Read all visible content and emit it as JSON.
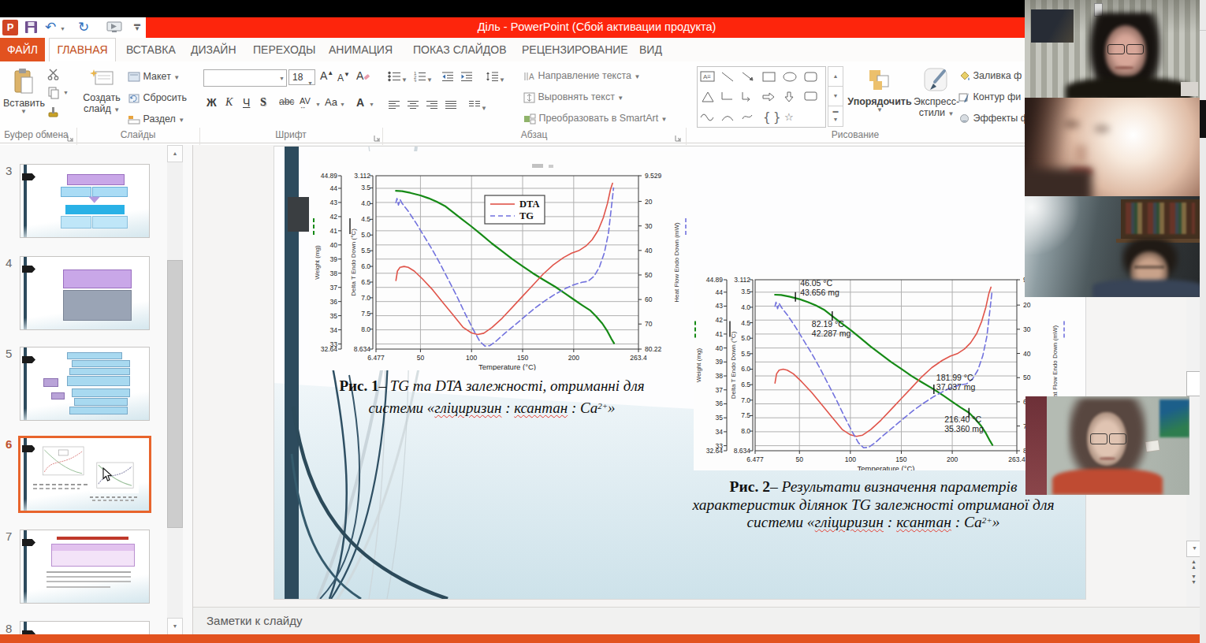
{
  "window": {
    "title": "Діль -  PowerPoint (Сбой активации продукта)"
  },
  "tabs": {
    "file": "ФАЙЛ",
    "items": [
      "ГЛАВНАЯ",
      "ВСТАВКА",
      "ДИЗАЙН",
      "ПЕРЕХОДЫ",
      "АНИМАЦИЯ",
      "ПОКАЗ СЛАЙДОВ",
      "РЕЦЕНЗИРОВАНИЕ",
      "ВИД"
    ]
  },
  "ribbon": {
    "clipboard_group": {
      "paste": "Вставить",
      "label": "Буфер обмена"
    },
    "slides_group": {
      "new_slide_1": "Создать",
      "new_slide_2": "слайд",
      "layout": "Макет",
      "reset": "Сбросить",
      "section": "Раздел",
      "label": "Слайды"
    },
    "font_group": {
      "font_name": "",
      "font_size": "18",
      "bold": "Ж",
      "italic": "К",
      "underline": "Ч",
      "shadow": "S",
      "strike": "abc",
      "spacing": "AV",
      "case": "Aa",
      "color": "А",
      "label": "Шрифт"
    },
    "paragraph_group": {
      "text_direction": "Направление текста",
      "align_text": "Выровнять текст",
      "smartart": "Преобразовать в SmartArt",
      "label": "Абзац"
    },
    "drawing_group": {
      "arrange": "Упорядочить",
      "quick_styles_1": "Экспресс-",
      "quick_styles_2": "стили",
      "fill": "Заливка ф",
      "outline": "Контур фи",
      "effects": "Эффекты ф",
      "label": "Рисование"
    }
  },
  "slide_panel": {
    "numbers": [
      "3",
      "4",
      "5",
      "6",
      "7",
      "8"
    ],
    "selected": "6"
  },
  "notes": {
    "label": "Заметки к слайду"
  },
  "captions": {
    "fig1": {
      "bold": "Рис. 1",
      "rest": "– TG та DTA залежності, отриманні для",
      "l2a": "системи «",
      "w1": "гліциризин",
      "m1": " : ",
      "w2": "ксантан",
      "m2": " : Ca",
      "sup": "2+",
      "end": "»"
    },
    "fig2": {
      "bold": "Рис. 2",
      "rest": "– Результати визначення параметрів",
      "line2": "характеристик ділянок TG залежності отриманої для",
      "l3a": "системи «",
      "w1": "гліциризин",
      "m1": " : ",
      "w2": "ксантан",
      "m2": " : Ca",
      "sup": "2+",
      "end": "»"
    }
  },
  "chart_data": {
    "type": "line",
    "xlabel": "Temperature (°C)",
    "x_ticks": [
      "6.477",
      "50",
      "100",
      "150",
      "200",
      "263.4"
    ],
    "axes": {
      "weight": {
        "title": "Weight (mg)",
        "top": "44.89",
        "bottom": "32.64",
        "ticks": [
          "44",
          "43",
          "42",
          "41",
          "40",
          "39",
          "38",
          "37",
          "36",
          "35",
          "34",
          "33"
        ],
        "range": [
          32.64,
          44.89
        ]
      },
      "delta": {
        "title": "Delta T Endo Down (°C)",
        "top": "3.112",
        "bottom": "8.634",
        "ticks": [
          "3.5",
          "4.0",
          "4.5",
          "5.0",
          "5.5",
          "6.0",
          "6.5",
          "7.0",
          "7.5",
          "8.0"
        ],
        "range": [
          3.112,
          8.634
        ]
      },
      "heat": {
        "title": "Heat Flow Endo Down (mW)",
        "top": "9.529",
        "bottom": "80.22",
        "ticks": [
          "20",
          "30",
          "40",
          "50",
          "60",
          "70"
        ],
        "range": [
          9.529,
          80.22
        ]
      }
    },
    "series": [
      {
        "name": "TG weight",
        "axis": "weight",
        "color": "#168a16",
        "style": "solid",
        "width": 2.2,
        "points": [
          [
            26,
            43.82
          ],
          [
            32,
            43.8
          ],
          [
            40,
            43.68
          ],
          [
            50,
            43.5
          ],
          [
            58,
            43.3
          ],
          [
            66,
            43.05
          ],
          [
            74,
            42.75
          ],
          [
            82.19,
            42.287
          ],
          [
            90,
            41.85
          ],
          [
            100,
            41.3
          ],
          [
            110,
            40.7
          ],
          [
            120,
            40.1
          ],
          [
            130,
            39.55
          ],
          [
            140,
            39.0
          ],
          [
            150,
            38.5
          ],
          [
            160,
            38.0
          ],
          [
            170,
            37.55
          ],
          [
            181.99,
            37.037
          ],
          [
            192,
            36.55
          ],
          [
            200,
            36.15
          ],
          [
            208,
            35.75
          ],
          [
            216.4,
            35.36
          ],
          [
            222,
            34.95
          ],
          [
            228,
            34.45
          ],
          [
            233,
            33.9
          ],
          [
            237,
            33.35
          ],
          [
            239.5,
            33.05
          ]
        ]
      },
      {
        "name": "DTA",
        "axis": "delta",
        "color": "#e0544a",
        "style": "solid",
        "width": 1.6,
        "points": [
          [
            26,
            6.45
          ],
          [
            27.5,
            6.15
          ],
          [
            30,
            6.03
          ],
          [
            34,
            6.0
          ],
          [
            38,
            6.03
          ],
          [
            44,
            6.15
          ],
          [
            52,
            6.4
          ],
          [
            62,
            6.75
          ],
          [
            72,
            7.15
          ],
          [
            82,
            7.55
          ],
          [
            92,
            7.95
          ],
          [
            100,
            8.12
          ],
          [
            106,
            8.17
          ],
          [
            112,
            8.13
          ],
          [
            120,
            7.95
          ],
          [
            130,
            7.65
          ],
          [
            140,
            7.3
          ],
          [
            150,
            6.95
          ],
          [
            160,
            6.6
          ],
          [
            170,
            6.25
          ],
          [
            180,
            5.95
          ],
          [
            190,
            5.72
          ],
          [
            198,
            5.58
          ],
          [
            205,
            5.5
          ],
          [
            212,
            5.35
          ],
          [
            218,
            5.15
          ],
          [
            224,
            4.85
          ],
          [
            229,
            4.45
          ],
          [
            233,
            4.0
          ],
          [
            236,
            3.55
          ],
          [
            238,
            3.35
          ]
        ]
      },
      {
        "name": "TG heat flow",
        "axis": "heat",
        "color": "#7272de",
        "style": "dashed",
        "width": 1.6,
        "points": [
          [
            26,
            20.5
          ],
          [
            27,
            18.8
          ],
          [
            28.5,
            21.5
          ],
          [
            30,
            19.2
          ],
          [
            32,
            20.8
          ],
          [
            38,
            24
          ],
          [
            46,
            29
          ],
          [
            54,
            34.5
          ],
          [
            62,
            40
          ],
          [
            70,
            46
          ],
          [
            78,
            52.5
          ],
          [
            86,
            59
          ],
          [
            94,
            66
          ],
          [
            102,
            72.5
          ],
          [
            108,
            77
          ],
          [
            113,
            79
          ],
          [
            118,
            78.8
          ],
          [
            124,
            77
          ],
          [
            132,
            74
          ],
          [
            142,
            70.5
          ],
          [
            152,
            67
          ],
          [
            162,
            63.5
          ],
          [
            172,
            60.5
          ],
          [
            182,
            57.8
          ],
          [
            192,
            55.5
          ],
          [
            200,
            54
          ],
          [
            208,
            53
          ],
          [
            214,
            52.6
          ],
          [
            220,
            50.5
          ],
          [
            225,
            47
          ],
          [
            230,
            41
          ],
          [
            234,
            33
          ],
          [
            237,
            22
          ],
          [
            239,
            14.5
          ]
        ]
      }
    ],
    "legend": {
      "entries": [
        {
          "label": "DTA"
        },
        {
          "label": "TG"
        }
      ]
    },
    "charts": [
      {
        "fig": "1",
        "legend": true,
        "annotations": []
      },
      {
        "fig": "2",
        "legend": false,
        "annotations": [
          {
            "line1": "46.05 °C",
            "line2": "43.656 mg",
            "t": 46.05,
            "mg": 43.656,
            "ox": 6,
            "oy": -14
          },
          {
            "line1": "82.19 °C",
            "line2": "42.287 mg",
            "t": 82.19,
            "mg": 42.287,
            "ox": -26,
            "oy": 14
          },
          {
            "line1": "181.99 °C",
            "line2": "37.037 mg",
            "t": 181.99,
            "mg": 37.037,
            "ox": 3,
            "oy": -11
          },
          {
            "line1": "216.40 °C",
            "line2": "35.360 mg",
            "t": 216.4,
            "mg": 35.36,
            "ox": -31,
            "oy": 12
          }
        ]
      }
    ]
  }
}
